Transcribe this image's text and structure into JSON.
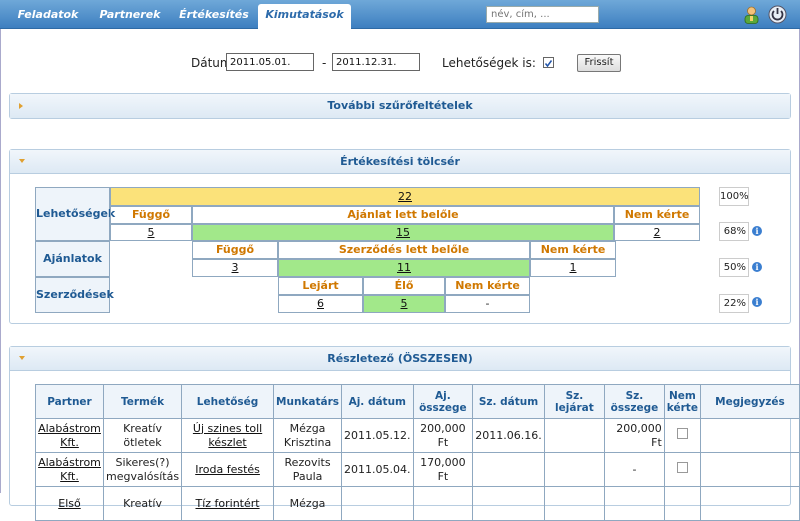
{
  "nav": {
    "tabs": [
      {
        "label": "Feladatok",
        "active": false
      },
      {
        "label": "Partnerek",
        "active": false
      },
      {
        "label": "Értékesítés",
        "active": false
      },
      {
        "label": "Kimutatások",
        "active": true
      }
    ],
    "search_placeholder": "név, cím, ..."
  },
  "filter": {
    "date_label": "Dátum:",
    "date_from": "2011.05.01.",
    "separator": "-",
    "date_to": "2011.12.31.",
    "opportunities_label": "Lehetőségek is:",
    "opportunities_checked": true,
    "refresh_label": "Frissít"
  },
  "more_filters": {
    "title": "További szűrőfeltételek"
  },
  "funnel": {
    "title": "Értékesítési tölcsér",
    "rows": {
      "opportunities": "Lehetőségek",
      "offers": "Ajánlatok",
      "contracts": "Szerződések"
    },
    "total": "22",
    "total_pct": "100%",
    "opp": {
      "pending_label": "Függő",
      "pending": "5",
      "became_offer_label": "Ajánlat lett belőle",
      "became_offer": "15",
      "not_requested_label": "Nem kérte",
      "not_requested": "2",
      "pct": "68%"
    },
    "offer": {
      "pending_label": "Függő",
      "pending": "3",
      "became_contract_label": "Szerződés lett belőle",
      "became_contract": "11",
      "not_requested_label": "Nem kérte",
      "not_requested": "1",
      "pct": "50%"
    },
    "contract": {
      "expired_label": "Lejárt",
      "expired": "6",
      "live_label": "Élő",
      "live": "5",
      "not_requested_label": "Nem kérte",
      "not_requested": "-",
      "pct": "22%"
    }
  },
  "details": {
    "title": "Részletező (ÖSSZESEN)",
    "columns": [
      "Partner",
      "Termék",
      "Lehetőség",
      "Munkatárs",
      "Aj. dátum",
      "Aj. összege",
      "Sz. dátum",
      "Sz. lejárat",
      "Sz. összege",
      "Nem kérte",
      "Megjegyzés"
    ],
    "rows": [
      {
        "partner": "Alabástrom Kft.",
        "product": "Kreatív ötletek",
        "opportunity": "Új szines toll készlet",
        "employee": "Mézga Krisztina",
        "offer_date": "2011.05.12.",
        "offer_amount": "200,000 Ft",
        "contract_date": "2011.06.16.",
        "contract_expiry": "",
        "contract_amount": "200,000 Ft",
        "note": ""
      },
      {
        "partner": "Alabástrom Kft.",
        "product": "Sikeres(?) megvalósítás",
        "opportunity": "Iroda festés",
        "employee": "Rezovits Paula",
        "offer_date": "2011.05.04.",
        "offer_amount": "170,000 Ft",
        "contract_date": "",
        "contract_expiry": "",
        "contract_amount": "-",
        "note": ""
      },
      {
        "partner": "Első",
        "product": "Kreatív",
        "opportunity": "Tíz forintért",
        "employee": "Mézga",
        "offer_date": "",
        "offer_amount": "",
        "contract_date": "",
        "contract_expiry": "",
        "contract_amount": "",
        "note": ""
      }
    ]
  }
}
